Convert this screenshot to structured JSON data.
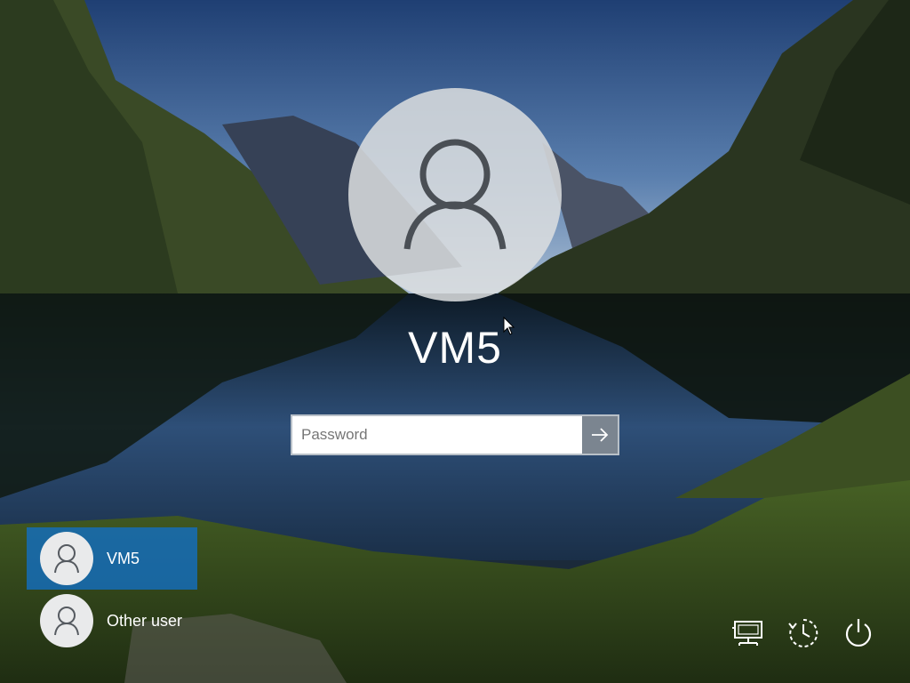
{
  "login": {
    "username": "VM5",
    "password_placeholder": "Password"
  },
  "users": [
    {
      "name": "VM5",
      "selected": true
    },
    {
      "name": "Other user",
      "selected": false
    }
  ],
  "tray": {
    "icons": [
      "network-icon",
      "ease-of-access-icon",
      "power-icon"
    ]
  },
  "colors": {
    "selected_user_bg": "#146ebe",
    "submit_button": "#7b8590",
    "avatar_bg": "#dcdee0"
  }
}
